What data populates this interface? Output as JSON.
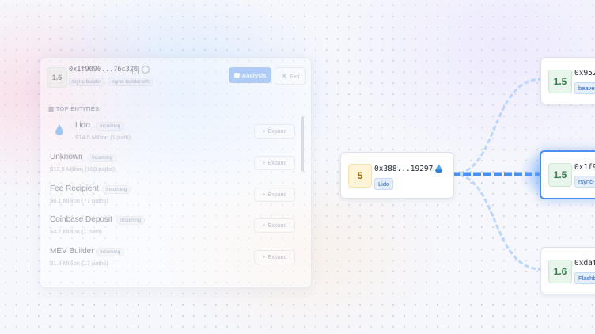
{
  "panel": {
    "score": "1.5",
    "address": "0x1f9090...76c326",
    "tags": [
      "rsync-builder",
      "rsync-builder.eth"
    ],
    "analysis_label": "Analysis",
    "exit_label": "Exit",
    "section_title": "TOP ENTITIES",
    "entities": [
      {
        "name": "Lido",
        "badge": "Incoming",
        "value": "$14.0 Million (1 path)",
        "expand": "Expand"
      },
      {
        "name": "Unknown",
        "badge": "Incoming",
        "value": "$13.6 Million (100 paths)",
        "expand": "Expand"
      },
      {
        "name": "Fee Recipient",
        "badge": "Incoming",
        "value": "$6.1 Million (77 paths)",
        "expand": "Expand"
      },
      {
        "name": "Coinbase Deposit",
        "badge": "Incoming",
        "value": "$4.7 Million (1 path)",
        "expand": "Expand"
      },
      {
        "name": "MEV Builder",
        "badge": "Incoming",
        "value": "$1.4 Million (17 paths)",
        "expand": "Expand"
      }
    ]
  },
  "nodes": {
    "source": {
      "score": "5",
      "address": "0x388...19297",
      "tag": "Lido",
      "icon": "lido-drop-icon"
    },
    "top": {
      "score": "1.5",
      "address": "0x952",
      "tag": "beaver"
    },
    "mid": {
      "score": "1.5",
      "address": "0x1f9",
      "tag": "rsync-"
    },
    "bottom": {
      "score": "1.6",
      "address": "0xdaf",
      "tag": "Flashb"
    }
  },
  "colors": {
    "accent": "#4a90f0",
    "score_green_bg": "#e7f5ea",
    "score_yellow_bg": "#fff4d8",
    "tag_blue": "#1f5fbf"
  }
}
